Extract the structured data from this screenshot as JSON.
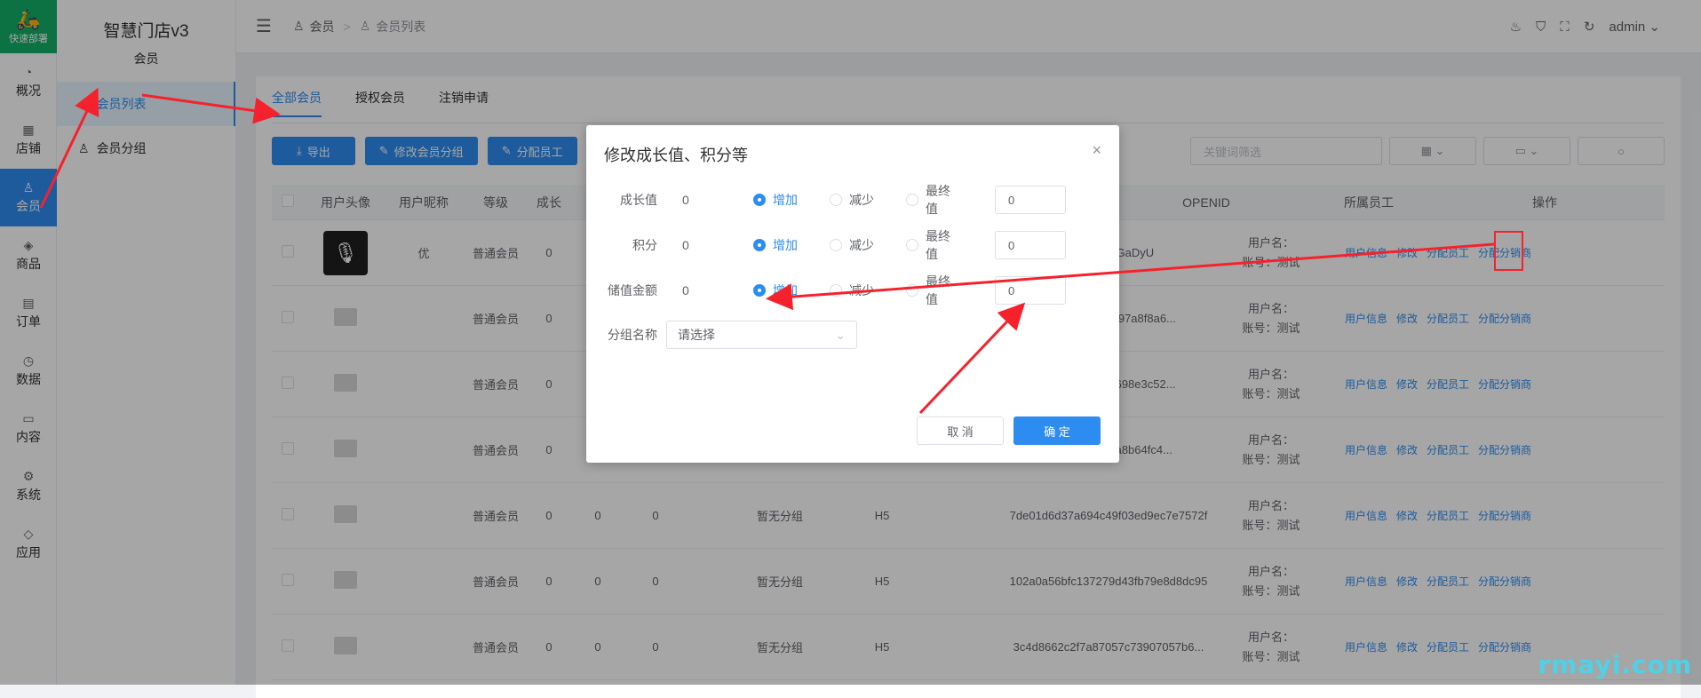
{
  "rail": {
    "logo_text": "快速部署",
    "items": [
      {
        "label": "概况",
        "icon": "dashboard-icon",
        "glyph": "◔"
      },
      {
        "label": "店铺",
        "icon": "store-icon",
        "glyph": "▦"
      },
      {
        "label": "会员",
        "icon": "user-icon",
        "glyph": "♙"
      },
      {
        "label": "商品",
        "icon": "goods-icon",
        "glyph": "◈"
      },
      {
        "label": "订单",
        "icon": "order-icon",
        "glyph": "▤"
      },
      {
        "label": "数据",
        "icon": "data-icon",
        "glyph": "◷"
      },
      {
        "label": "内容",
        "icon": "content-icon",
        "glyph": "▭"
      },
      {
        "label": "系统",
        "icon": "system-icon",
        "glyph": "⚙"
      },
      {
        "label": "应用",
        "icon": "app-icon",
        "glyph": "◇"
      }
    ]
  },
  "sub": {
    "store_name": "智慧门店v3",
    "section": "会员",
    "items": [
      {
        "label": "会员列表"
      },
      {
        "label": "会员分组"
      }
    ]
  },
  "header": {
    "crumb1": "会员",
    "crumb_sep": ">",
    "crumb2": "会员列表",
    "user": "admin"
  },
  "tabs": [
    "全部会员",
    "授权会员",
    "注销申请"
  ],
  "toolbar": {
    "export": "导出",
    "edit_group": "修改会员分组",
    "assign_staff": "分配员工"
  },
  "filters": {
    "keyword_placeholder": "关键词筛选"
  },
  "table": {
    "headers": [
      "用户头像",
      "用户昵称",
      "等级",
      "成长",
      "OPENID",
      "所属员工",
      "操作"
    ],
    "rows": [
      {
        "nick": "优",
        "level": "普通会员",
        "growth": "0",
        "c2": "",
        "c3": "",
        "group": "",
        "src": "",
        "openid": "Vw.YpDu6GaDyU",
        "staff1": "用户名：",
        "staff2": "账号：测试"
      },
      {
        "nick": "",
        "level": "普通会员",
        "growth": "0",
        "c2": "",
        "c3": "",
        "group": "",
        "src": "",
        "openid": "408d4d386bab97a8f8a6...",
        "staff1": "用户名：",
        "staff2": "账号：测试"
      },
      {
        "nick": "",
        "level": "普通会员",
        "growth": "0",
        "c2": "",
        "c3": "",
        "group": "",
        "src": "",
        "openid": "7f83859aa035698e3c52...",
        "staff1": "用户名：",
        "staff2": "账号：测试"
      },
      {
        "nick": "",
        "level": "普通会员",
        "growth": "0",
        "c2": "",
        "c3": "",
        "group": "",
        "src": "",
        "openid": "b38b93599bba8b64fc4...",
        "staff1": "用户名：",
        "staff2": "账号：测试"
      },
      {
        "nick": "",
        "level": "普通会员",
        "growth": "0",
        "c2": "0",
        "c3": "0",
        "group": "暂无分组",
        "src": "H5",
        "openid": "7de01d6d37a694c49f03ed9ec7e7572f",
        "staff1": "用户名：",
        "staff2": "账号：测试"
      },
      {
        "nick": "",
        "level": "普通会员",
        "growth": "0",
        "c2": "0",
        "c3": "0",
        "group": "暂无分组",
        "src": "H5",
        "openid": "102a0a56bfc137279d43fb79e8d8dc95",
        "staff1": "用户名：",
        "staff2": "账号：测试"
      },
      {
        "nick": "",
        "level": "普通会员",
        "growth": "0",
        "c2": "0",
        "c3": "0",
        "group": "暂无分组",
        "src": "H5",
        "openid": "3c4d8662c2f7a87057c73907057b6...",
        "staff1": "用户名：",
        "staff2": "账号：测试"
      }
    ],
    "actions": [
      "用户信息",
      "修改",
      "分配员工",
      "分配分销商"
    ]
  },
  "dialog": {
    "title": "修改成长值、积分等",
    "close": "×",
    "rows": [
      {
        "label": "成长值",
        "current": "0",
        "input": "0"
      },
      {
        "label": "积分",
        "current": "0",
        "input": "0"
      },
      {
        "label": "储值金额",
        "current": "0",
        "input": "0"
      }
    ],
    "options": [
      "增加",
      "减少",
      "最终值"
    ],
    "group_label": "分组名称",
    "group_placeholder": "请选择",
    "cancel": "取 消",
    "ok": "确 定"
  },
  "watermark": "rmayi.com",
  "colors": {
    "primary": "#2d8cf0",
    "logo_bg": "#13ae67",
    "annotation": "#f5222d",
    "watermark": "#4fd1e8"
  }
}
